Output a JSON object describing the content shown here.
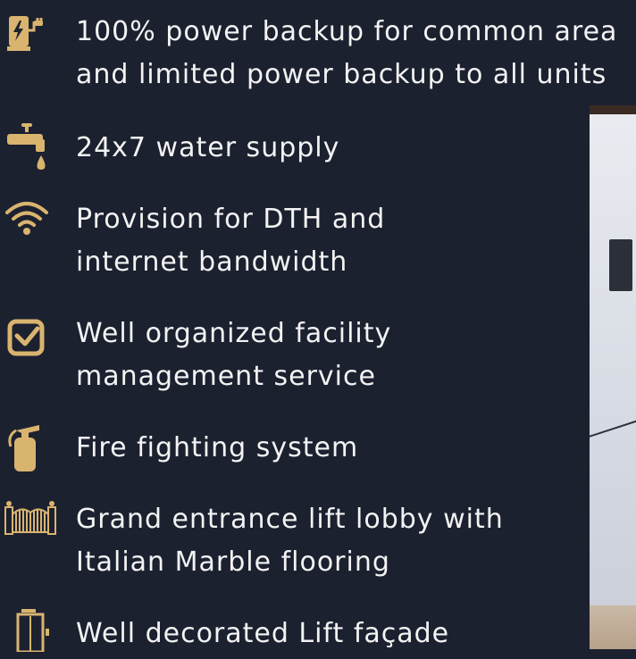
{
  "accent_color": "#d9b46f",
  "amenities": [
    {
      "icon": "ev-charger-icon",
      "lines": [
        "100% power backup for common area",
        "and limited power backup to all units"
      ]
    },
    {
      "icon": "water-tap-icon",
      "lines": [
        "24x7 water supply"
      ]
    },
    {
      "icon": "wifi-icon",
      "lines": [
        "Provision for DTH and",
        "internet bandwidth"
      ]
    },
    {
      "icon": "checkbox-icon",
      "lines": [
        "Well organized facility",
        "management service"
      ]
    },
    {
      "icon": "fire-extinguisher-icon",
      "lines": [
        "Fire fighting system"
      ]
    },
    {
      "icon": "gate-icon",
      "lines": [
        "Grand entrance lift lobby with",
        "Italian Marble flooring"
      ]
    },
    {
      "icon": "elevator-icon",
      "lines": [
        "Well decorated Lift façade"
      ]
    }
  ]
}
